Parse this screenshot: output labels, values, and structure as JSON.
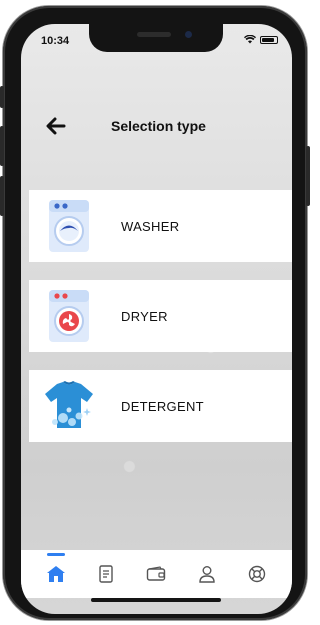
{
  "status": {
    "time": "10:34"
  },
  "header": {
    "title": "Selection type"
  },
  "options": [
    {
      "label": "WASHER",
      "icon": "washer-icon"
    },
    {
      "label": "DRYER",
      "icon": "dryer-icon"
    },
    {
      "label": "DETERGENT",
      "icon": "detergent-shirt-icon"
    }
  ],
  "tabbar": {
    "items": [
      {
        "icon": "home-icon",
        "active": true
      },
      {
        "icon": "document-icon",
        "active": false
      },
      {
        "icon": "wallet-icon",
        "active": false
      },
      {
        "icon": "profile-icon",
        "active": false
      },
      {
        "icon": "support-icon",
        "active": false
      }
    ]
  },
  "colors": {
    "accent": "#2f7ff0",
    "washer": "#5b8dd9",
    "dryer": "#e9474b",
    "detergent": "#2b8fd6"
  }
}
